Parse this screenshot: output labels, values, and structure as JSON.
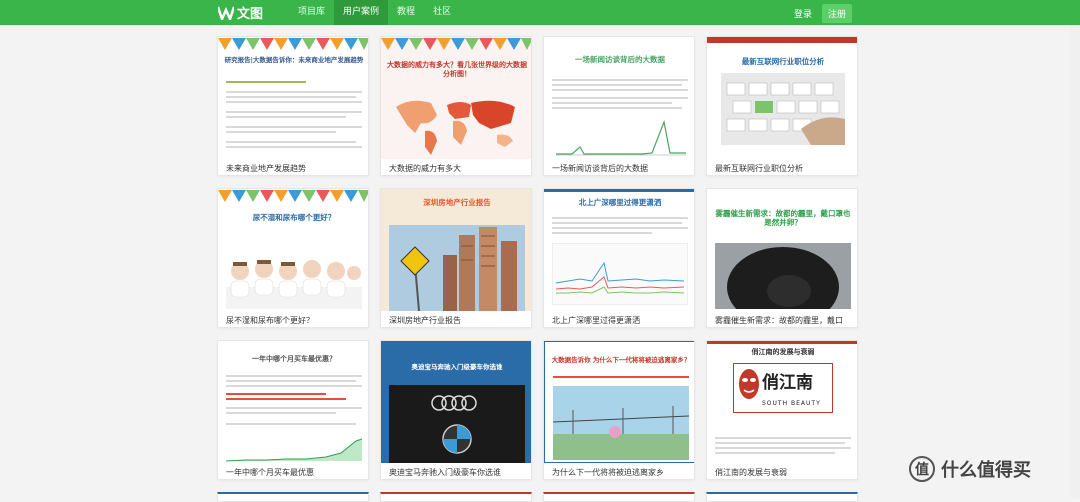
{
  "header": {
    "logo_text": "文图",
    "nav": [
      "项目库",
      "用户案例",
      "教程",
      "社区"
    ],
    "active_tab": "用户案例",
    "login": "登录",
    "register": "注册",
    "brand_color": "#39b54a"
  },
  "cards": [
    {
      "caption": "未来商业地产发展趋势",
      "thumb_title": "研究报告|大数据告诉你：未来商业地产发展趋势"
    },
    {
      "caption": "大数据的威力有多大",
      "thumb_title": "大数据的威力有多大？看几张世界级的大数据分析图！"
    },
    {
      "caption": "一场新闻访谈背后的大数据",
      "thumb_title": "一场新闻访谈背后的大数据"
    },
    {
      "caption": "最新互联网行业职位分析",
      "thumb_title": "最新互联网行业职位分析"
    },
    {
      "caption": "尿不湿和尿布哪个更好？",
      "thumb_title": "尿不湿和尿布哪个更好？"
    },
    {
      "caption": "深圳房地产行业报告",
      "thumb_title": "深圳房地产行业报告"
    },
    {
      "caption": "北上广深哪里过得更潇洒",
      "thumb_title": "北上广深哪里过得更潇洒"
    },
    {
      "caption": "雾霾催生新需求：故都的霾里，戴口",
      "thumb_title": "雾霾催生新需求：故都的霾里，戴口罩也是然并卵？"
    },
    {
      "caption": "一年中哪个月买车最优惠",
      "thumb_title": "一年中哪个月买车最优惠？"
    },
    {
      "caption": "奥迪宝马奔驰入门级豪车你选谁",
      "thumb_title": "奥迪宝马奔驰入门级豪车你选谁"
    },
    {
      "caption": "为什么下一代将将被迫逃离家乡",
      "thumb_title": "大数据告诉你 为什么下一代将将被迫逃离家乡？"
    },
    {
      "caption": "俏江南的发展与衰弱",
      "thumb_title": "俏江南的发展与衰弱"
    }
  ],
  "logo_brand": {
    "text1": "俏江南",
    "text2": "SOUTH BEAUTY"
  },
  "watermark": "什么值得买"
}
